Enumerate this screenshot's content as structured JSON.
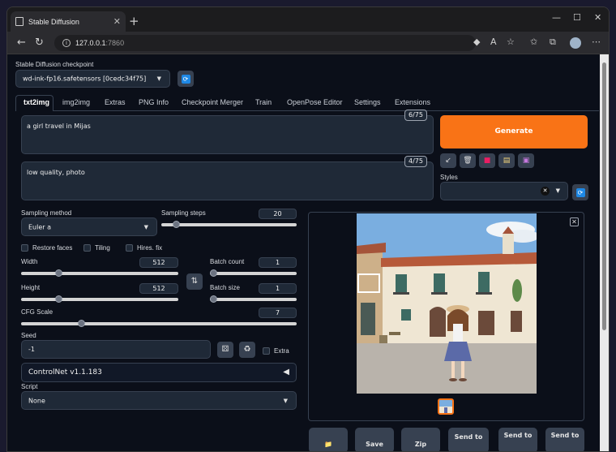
{
  "browser": {
    "tab_title": "Stable Diffusion",
    "tab_close": "✕",
    "new_tab": "+",
    "win_min": "—",
    "win_max": "☐",
    "win_close": "✕",
    "url_host": "127.0.0.1",
    "url_port": ":7860"
  },
  "checkpoint": {
    "label": "Stable Diffusion checkpoint",
    "value": "wd-ink-fp16.safetensors [0cedc34f75]"
  },
  "tabs": [
    "txt2img",
    "img2img",
    "Extras",
    "PNG Info",
    "Checkpoint Merger",
    "Train",
    "OpenPose Editor",
    "Settings",
    "Extensions"
  ],
  "prompt": {
    "positive": "a girl travel in Mijas",
    "positive_count": "6/75",
    "negative": "low quality, photo",
    "negative_count": "4/75"
  },
  "generate_label": "Generate",
  "styles_label": "Styles",
  "sampling": {
    "method_label": "Sampling method",
    "method_value": "Euler a",
    "steps_label": "Sampling steps",
    "steps_value": "20",
    "steps_fraction": 0.13
  },
  "options": {
    "restore_faces": "Restore faces",
    "tiling": "Tiling",
    "hires_fix": "Hires. fix"
  },
  "size": {
    "width_label": "Width",
    "width_value": "512",
    "height_label": "Height",
    "height_value": "512",
    "batch_count_label": "Batch count",
    "batch_count_value": "1",
    "batch_size_label": "Batch size",
    "batch_size_value": "1"
  },
  "cfg": {
    "label": "CFG Scale",
    "value": "7"
  },
  "seed": {
    "label": "Seed",
    "value": "-1",
    "extra_label": "Extra"
  },
  "controlnet": {
    "label": "ControlNet v1.1.183",
    "arrow": "◀"
  },
  "script": {
    "label": "Script",
    "value": "None"
  },
  "send_buttons": [
    {
      "label": "📁"
    },
    {
      "label": "Save"
    },
    {
      "label": "Zip"
    },
    {
      "label": "Send to"
    },
    {
      "label": "Send to"
    },
    {
      "label": "Send to"
    }
  ],
  "colors": {
    "accent": "#f97316",
    "bg": "#0b0f19",
    "panel": "#1f2937"
  }
}
